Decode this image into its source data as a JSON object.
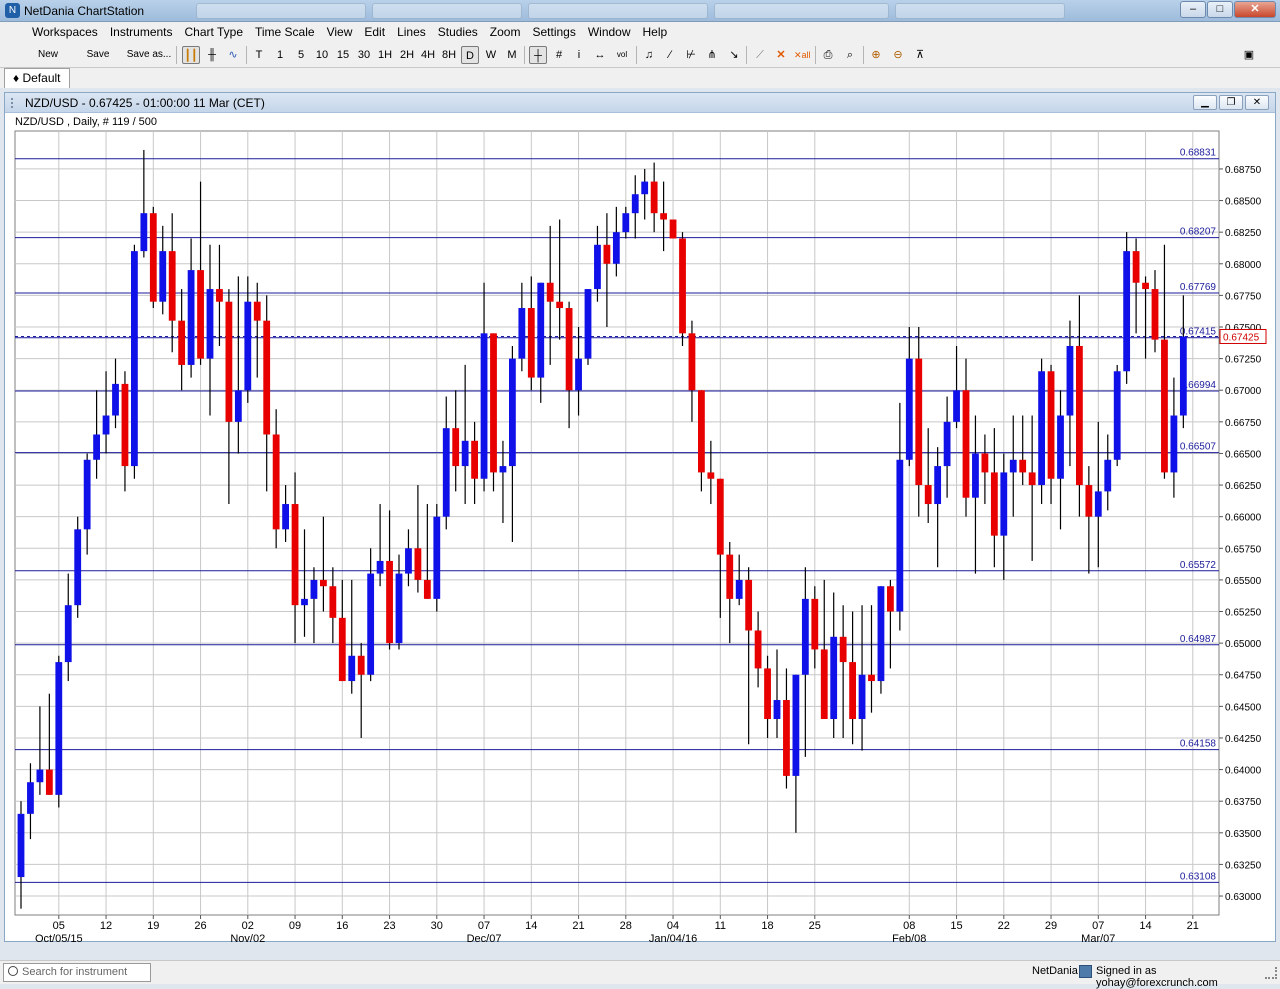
{
  "app": {
    "title": "NetDania ChartStation",
    "window_controls": [
      "–",
      "□",
      "✕"
    ]
  },
  "menu": [
    "Workspaces",
    "Instruments",
    "Chart Type",
    "Time Scale",
    "View",
    "Edit",
    "Lines",
    "Studies",
    "Zoom",
    "Settings",
    "Window",
    "Help"
  ],
  "toolbar": {
    "text_buttons": [
      "New",
      "Save",
      "Save as..."
    ],
    "time_buttons": [
      "T",
      "1",
      "5",
      "10",
      "15",
      "30",
      "1H",
      "2H",
      "4H",
      "8H",
      "D",
      "W",
      "M"
    ],
    "active_time": "D"
  },
  "workspace_tab": "Default",
  "chart_window": {
    "title": "NZD/USD - 0.67425 - 01:00:00  11 Mar (CET)",
    "subtitle": "NZD/USD , Daily, # 119 / 500",
    "controls": [
      "▁",
      "❐",
      "✕"
    ]
  },
  "status": {
    "search_placeholder": "Search for instrument",
    "brand": "NetDania",
    "signed_in": "Signed in as yohay@forexcrunch.com"
  },
  "chart_data": {
    "type": "candlestick",
    "instrument": "NZD/USD",
    "period": "Daily",
    "ylim": [
      0.6285,
      0.6905
    ],
    "y_ticks": [
      "0.68750",
      "0.68500",
      "0.68250",
      "0.68000",
      "0.67750",
      "0.67500",
      "0.67250",
      "0.67000",
      "0.66750",
      "0.66500",
      "0.66250",
      "0.66000",
      "0.65750",
      "0.65500",
      "0.65250",
      "0.65000",
      "0.64750",
      "0.64500",
      "0.64250",
      "0.64000",
      "0.63750",
      "0.63500",
      "0.63250",
      "0.63000"
    ],
    "x_ticks": [
      {
        "day": "05",
        "date": "Oct/05/15",
        "i": 4
      },
      {
        "day": "12",
        "date": "",
        "i": 9
      },
      {
        "day": "19",
        "date": "",
        "i": 14
      },
      {
        "day": "26",
        "date": "",
        "i": 19
      },
      {
        "day": "02",
        "date": "Nov/02",
        "i": 24
      },
      {
        "day": "09",
        "date": "",
        "i": 29
      },
      {
        "day": "16",
        "date": "",
        "i": 34
      },
      {
        "day": "23",
        "date": "",
        "i": 39
      },
      {
        "day": "30",
        "date": "",
        "i": 44
      },
      {
        "day": "07",
        "date": "Dec/07",
        "i": 49
      },
      {
        "day": "14",
        "date": "",
        "i": 54
      },
      {
        "day": "21",
        "date": "",
        "i": 59
      },
      {
        "day": "28",
        "date": "",
        "i": 64
      },
      {
        "day": "04",
        "date": "Jan/04/16",
        "i": 69
      },
      {
        "day": "11",
        "date": "",
        "i": 74
      },
      {
        "day": "18",
        "date": "",
        "i": 79
      },
      {
        "day": "25",
        "date": "",
        "i": 84
      },
      {
        "day": "08",
        "date": "Feb/08",
        "i": 94
      },
      {
        "day": "15",
        "date": "",
        "i": 99
      },
      {
        "day": "22",
        "date": "",
        "i": 104
      },
      {
        "day": "29",
        "date": "",
        "i": 109
      },
      {
        "day": "07",
        "date": "Mar/07",
        "i": 114
      },
      {
        "day": "14",
        "date": "",
        "i": 119
      },
      {
        "day": "21",
        "date": "",
        "i": 124
      }
    ],
    "hlines": [
      "0.68831",
      "0.68207",
      "0.67769",
      "0.67415",
      "0.66994",
      "0.66507",
      "0.65572",
      "0.64987",
      "0.64158",
      "0.63108"
    ],
    "current_price": "0.67425",
    "candles": [
      [
        0.6315,
        0.6375,
        0.629,
        0.6365
      ],
      [
        0.6365,
        0.6405,
        0.6345,
        0.639
      ],
      [
        0.639,
        0.645,
        0.638,
        0.64
      ],
      [
        0.64,
        0.646,
        0.638,
        0.638
      ],
      [
        0.638,
        0.649,
        0.637,
        0.6485
      ],
      [
        0.6485,
        0.6555,
        0.647,
        0.653
      ],
      [
        0.653,
        0.66,
        0.652,
        0.659
      ],
      [
        0.659,
        0.665,
        0.657,
        0.6645
      ],
      [
        0.6645,
        0.67,
        0.663,
        0.6665
      ],
      [
        0.6665,
        0.6715,
        0.665,
        0.668
      ],
      [
        0.668,
        0.6725,
        0.667,
        0.6705
      ],
      [
        0.6705,
        0.6715,
        0.662,
        0.664
      ],
      [
        0.664,
        0.6815,
        0.663,
        0.681
      ],
      [
        0.681,
        0.689,
        0.6805,
        0.684
      ],
      [
        0.684,
        0.6845,
        0.6765,
        0.677
      ],
      [
        0.677,
        0.683,
        0.676,
        0.681
      ],
      [
        0.681,
        0.684,
        0.673,
        0.6755
      ],
      [
        0.6755,
        0.678,
        0.67,
        0.672
      ],
      [
        0.672,
        0.682,
        0.671,
        0.6795
      ],
      [
        0.6795,
        0.6865,
        0.672,
        0.6725
      ],
      [
        0.6725,
        0.6815,
        0.668,
        0.678
      ],
      [
        0.678,
        0.6815,
        0.6735,
        0.677
      ],
      [
        0.677,
        0.678,
        0.661,
        0.6675
      ],
      [
        0.6675,
        0.679,
        0.665,
        0.67
      ],
      [
        0.67,
        0.679,
        0.669,
        0.677
      ],
      [
        0.677,
        0.6785,
        0.671,
        0.6755
      ],
      [
        0.6755,
        0.6775,
        0.662,
        0.6665
      ],
      [
        0.6665,
        0.6685,
        0.6575,
        0.659
      ],
      [
        0.659,
        0.6625,
        0.658,
        0.661
      ],
      [
        0.661,
        0.6635,
        0.65,
        0.653
      ],
      [
        0.653,
        0.659,
        0.6505,
        0.6535
      ],
      [
        0.6535,
        0.656,
        0.65,
        0.655
      ],
      [
        0.655,
        0.66,
        0.6525,
        0.6545
      ],
      [
        0.6545,
        0.656,
        0.65,
        0.652
      ],
      [
        0.652,
        0.655,
        0.648,
        0.647
      ],
      [
        0.647,
        0.655,
        0.646,
        0.649
      ],
      [
        0.649,
        0.65,
        0.6425,
        0.6475
      ],
      [
        0.6475,
        0.6575,
        0.647,
        0.6555
      ],
      [
        0.6555,
        0.661,
        0.6545,
        0.6565
      ],
      [
        0.6565,
        0.6605,
        0.6495,
        0.65
      ],
      [
        0.65,
        0.657,
        0.6495,
        0.6555
      ],
      [
        0.6555,
        0.659,
        0.6545,
        0.6575
      ],
      [
        0.6575,
        0.6625,
        0.654,
        0.655
      ],
      [
        0.655,
        0.661,
        0.6535,
        0.6535
      ],
      [
        0.6535,
        0.661,
        0.6525,
        0.66
      ],
      [
        0.66,
        0.6695,
        0.659,
        0.667
      ],
      [
        0.667,
        0.67,
        0.662,
        0.664
      ],
      [
        0.664,
        0.672,
        0.661,
        0.666
      ],
      [
        0.666,
        0.6675,
        0.661,
        0.663
      ],
      [
        0.663,
        0.6785,
        0.662,
        0.6745
      ],
      [
        0.6745,
        0.674,
        0.662,
        0.6635
      ],
      [
        0.6635,
        0.666,
        0.6595,
        0.664
      ],
      [
        0.664,
        0.6735,
        0.658,
        0.6725
      ],
      [
        0.6725,
        0.6785,
        0.6715,
        0.6765
      ],
      [
        0.6765,
        0.679,
        0.67,
        0.671
      ],
      [
        0.671,
        0.6785,
        0.669,
        0.6785
      ],
      [
        0.6785,
        0.683,
        0.672,
        0.677
      ],
      [
        0.677,
        0.6835,
        0.674,
        0.6765
      ],
      [
        0.6765,
        0.677,
        0.667,
        0.67
      ],
      [
        0.67,
        0.675,
        0.668,
        0.6725
      ],
      [
        0.6725,
        0.678,
        0.672,
        0.678
      ],
      [
        0.678,
        0.683,
        0.677,
        0.6815
      ],
      [
        0.6815,
        0.684,
        0.675,
        0.68
      ],
      [
        0.68,
        0.6845,
        0.679,
        0.6825
      ],
      [
        0.6825,
        0.6845,
        0.682,
        0.684
      ],
      [
        0.684,
        0.687,
        0.682,
        0.6855
      ],
      [
        0.6855,
        0.6875,
        0.6835,
        0.6865
      ],
      [
        0.6865,
        0.688,
        0.6825,
        0.684
      ],
      [
        0.684,
        0.6865,
        0.681,
        0.6835
      ],
      [
        0.6835,
        0.6835,
        0.682,
        0.682
      ],
      [
        0.682,
        0.6825,
        0.6735,
        0.6745
      ],
      [
        0.6745,
        0.6755,
        0.6675,
        0.67
      ],
      [
        0.67,
        0.67,
        0.662,
        0.6635
      ],
      [
        0.6635,
        0.666,
        0.661,
        0.663
      ],
      [
        0.663,
        0.6625,
        0.652,
        0.657
      ],
      [
        0.657,
        0.658,
        0.65,
        0.6535
      ],
      [
        0.6535,
        0.657,
        0.653,
        0.655
      ],
      [
        0.655,
        0.656,
        0.642,
        0.651
      ],
      [
        0.651,
        0.6525,
        0.6465,
        0.648
      ],
      [
        0.648,
        0.649,
        0.6425,
        0.644
      ],
      [
        0.644,
        0.6495,
        0.6425,
        0.6455
      ],
      [
        0.6455,
        0.648,
        0.6385,
        0.6395
      ],
      [
        0.6395,
        0.6475,
        0.635,
        0.6475
      ],
      [
        0.6475,
        0.656,
        0.641,
        0.6535
      ],
      [
        0.6535,
        0.6545,
        0.648,
        0.6495
      ],
      [
        0.6495,
        0.655,
        0.645,
        0.644
      ],
      [
        0.644,
        0.654,
        0.6425,
        0.6505
      ],
      [
        0.6505,
        0.653,
        0.6425,
        0.6485
      ],
      [
        0.6485,
        0.6525,
        0.642,
        0.644
      ],
      [
        0.644,
        0.653,
        0.6415,
        0.6475
      ],
      [
        0.6475,
        0.653,
        0.6445,
        0.647
      ],
      [
        0.647,
        0.6545,
        0.646,
        0.6545
      ],
      [
        0.6545,
        0.655,
        0.648,
        0.6525
      ],
      [
        0.6525,
        0.669,
        0.651,
        0.6645
      ],
      [
        0.6645,
        0.675,
        0.664,
        0.6725
      ],
      [
        0.6725,
        0.675,
        0.66,
        0.6625
      ],
      [
        0.6625,
        0.667,
        0.6595,
        0.661
      ],
      [
        0.661,
        0.6655,
        0.656,
        0.664
      ],
      [
        0.664,
        0.6695,
        0.6615,
        0.6675
      ],
      [
        0.6675,
        0.6735,
        0.667,
        0.67
      ],
      [
        0.67,
        0.6725,
        0.66,
        0.6615
      ],
      [
        0.6615,
        0.668,
        0.6555,
        0.665
      ],
      [
        0.665,
        0.6665,
        0.661,
        0.6635
      ],
      [
        0.6635,
        0.667,
        0.656,
        0.6585
      ],
      [
        0.6585,
        0.665,
        0.655,
        0.6635
      ],
      [
        0.6635,
        0.668,
        0.66,
        0.6645
      ],
      [
        0.6645,
        0.668,
        0.6625,
        0.6635
      ],
      [
        0.6635,
        0.668,
        0.6565,
        0.6625
      ],
      [
        0.6625,
        0.6725,
        0.661,
        0.6715
      ],
      [
        0.6715,
        0.672,
        0.661,
        0.663
      ],
      [
        0.663,
        0.67,
        0.659,
        0.668
      ],
      [
        0.668,
        0.6755,
        0.664,
        0.6735
      ],
      [
        0.6735,
        0.6775,
        0.66,
        0.6625
      ],
      [
        0.6625,
        0.664,
        0.6555,
        0.66
      ],
      [
        0.66,
        0.6675,
        0.656,
        0.662
      ],
      [
        0.662,
        0.6665,
        0.6605,
        0.6645
      ],
      [
        0.6645,
        0.672,
        0.664,
        0.6715
      ],
      [
        0.6715,
        0.6825,
        0.6705,
        0.681
      ],
      [
        0.681,
        0.682,
        0.6745,
        0.6785
      ],
      [
        0.6785,
        0.679,
        0.6725,
        0.678
      ],
      [
        0.678,
        0.6795,
        0.673,
        0.674
      ],
      [
        0.674,
        0.6815,
        0.663,
        0.6635
      ],
      [
        0.6635,
        0.671,
        0.6615,
        0.668
      ],
      [
        0.668,
        0.6775,
        0.667,
        0.67425
      ]
    ]
  }
}
